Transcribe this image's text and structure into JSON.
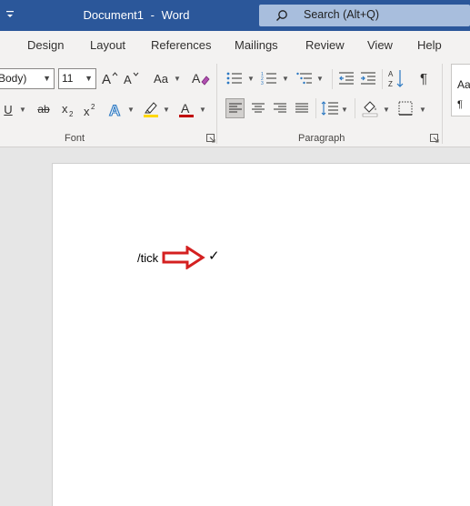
{
  "titlebar": {
    "menu_glyph": "⇄",
    "document_name": "Document1",
    "separator": "-",
    "app_name": "Word",
    "search_placeholder": "Search (Alt+Q)"
  },
  "tabs": [
    "Design",
    "Layout",
    "References",
    "Mailings",
    "Review",
    "View",
    "Help"
  ],
  "ribbon": {
    "font_name": "Body)",
    "font_size": "11",
    "font_group_label": "Font",
    "paragraph_group_label": "Paragraph",
    "change_case_label": "Aa",
    "styles_preview": [
      "Aa",
      "¶"
    ]
  },
  "document": {
    "typed_text": "/tick",
    "result_symbol": "✓"
  },
  "colors": {
    "titlebar": "#2b579a",
    "highlight": "#ffd800",
    "font_color": "#c00000",
    "arrow": "#d42020"
  }
}
